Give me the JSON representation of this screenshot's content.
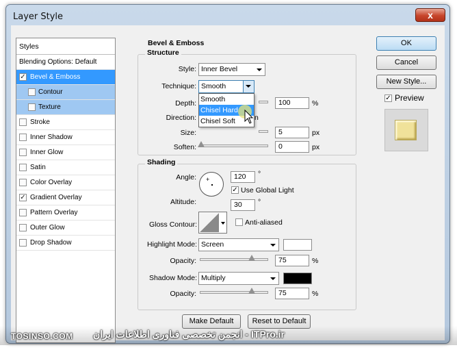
{
  "window": {
    "title": "Layer Style",
    "close_label": "x"
  },
  "styles": {
    "header": "Styles",
    "blending_options": "Blending Options: Default",
    "items": [
      {
        "label": "Bevel & Emboss",
        "checked": true
      },
      {
        "label": "Contour",
        "checked": false
      },
      {
        "label": "Texture",
        "checked": false
      },
      {
        "label": "Stroke",
        "checked": false
      },
      {
        "label": "Inner Shadow",
        "checked": false
      },
      {
        "label": "Inner Glow",
        "checked": false
      },
      {
        "label": "Satin",
        "checked": false
      },
      {
        "label": "Color Overlay",
        "checked": false
      },
      {
        "label": "Gradient Overlay",
        "checked": true
      },
      {
        "label": "Pattern Overlay",
        "checked": false
      },
      {
        "label": "Outer Glow",
        "checked": false
      },
      {
        "label": "Drop Shadow",
        "checked": false
      }
    ],
    "check_mark": "✓"
  },
  "bevel": {
    "section_title": "Bevel & Emboss",
    "structure_title": "Structure",
    "style_label": "Style:",
    "style_value": "Inner Bevel",
    "technique_label": "Technique:",
    "technique_value": "Smooth",
    "technique_options": [
      "Smooth",
      "Chisel Hard",
      "Chisel Soft"
    ],
    "depth_label": "Depth:",
    "depth_value": "100",
    "depth_unit": "%",
    "direction_label": "Direction:",
    "direction_partial": "n",
    "size_label": "Size:",
    "size_value": "5",
    "size_unit": "px",
    "soften_label": "Soften:",
    "soften_value": "0",
    "soften_unit": "px"
  },
  "shading": {
    "title": "Shading",
    "angle_label": "Angle:",
    "angle_value": "120",
    "degree": "°",
    "global_light_label": "Use Global Light",
    "global_light_checked": true,
    "altitude_label": "Altitude:",
    "altitude_value": "30",
    "gloss_contour_label": "Gloss Contour:",
    "anti_aliased_label": "Anti-aliased",
    "highlight_mode_label": "Highlight Mode:",
    "highlight_mode_value": "Screen",
    "highlight_color": "#ffffff",
    "highlight_opacity_label": "Opacity:",
    "highlight_opacity_value": "75",
    "shadow_mode_label": "Shadow Mode:",
    "shadow_mode_value": "Multiply",
    "shadow_color": "#000000",
    "shadow_opacity_label": "Opacity:",
    "shadow_opacity_value": "75",
    "percent": "%"
  },
  "footer_buttons": {
    "make_default": "Make Default",
    "reset_default": "Reset to Default"
  },
  "right_buttons": {
    "ok": "OK",
    "cancel": "Cancel",
    "new_style": "New Style...",
    "preview": "Preview"
  },
  "watermark": {
    "left": "TOSINSO.COM",
    "right": "ITPro.ir - انجمن تخصصی فناوری اطلاعات ایران"
  },
  "colors": {
    "selection": "#3399ff",
    "preview_swatch": "#f0e29a"
  }
}
